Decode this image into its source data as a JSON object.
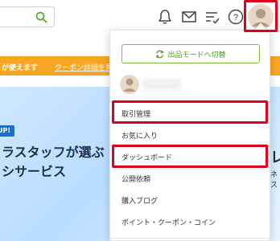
{
  "header": {
    "search_placeholder": ""
  },
  "banner": {
    "text": "が使えます",
    "link": "クーポン詳細を見る"
  },
  "hero": {
    "badge": "UP!",
    "line1": "ラスタッフが選ぶ",
    "line2": "シサービス",
    "right_big": "レ",
    "right_small": "ネス"
  },
  "dropdown": {
    "mode_button": "出品モードへ切替",
    "menu_items": [
      "取引管理",
      "お気に入り",
      "ダッシュボード",
      "公開依頼",
      "購入ブログ",
      "ポイント・クーポン・コイン"
    ]
  },
  "colors": {
    "accent_green": "#4e9b19",
    "banner_orange": "#f6a623",
    "highlight_red": "#e0001a"
  },
  "icons": {
    "search": "search-icon",
    "bell": "bell-icon",
    "mail": "mail-icon",
    "list": "checklist-icon",
    "help": "help-icon",
    "avatar": "avatar-icon",
    "switch": "refresh-icon"
  }
}
